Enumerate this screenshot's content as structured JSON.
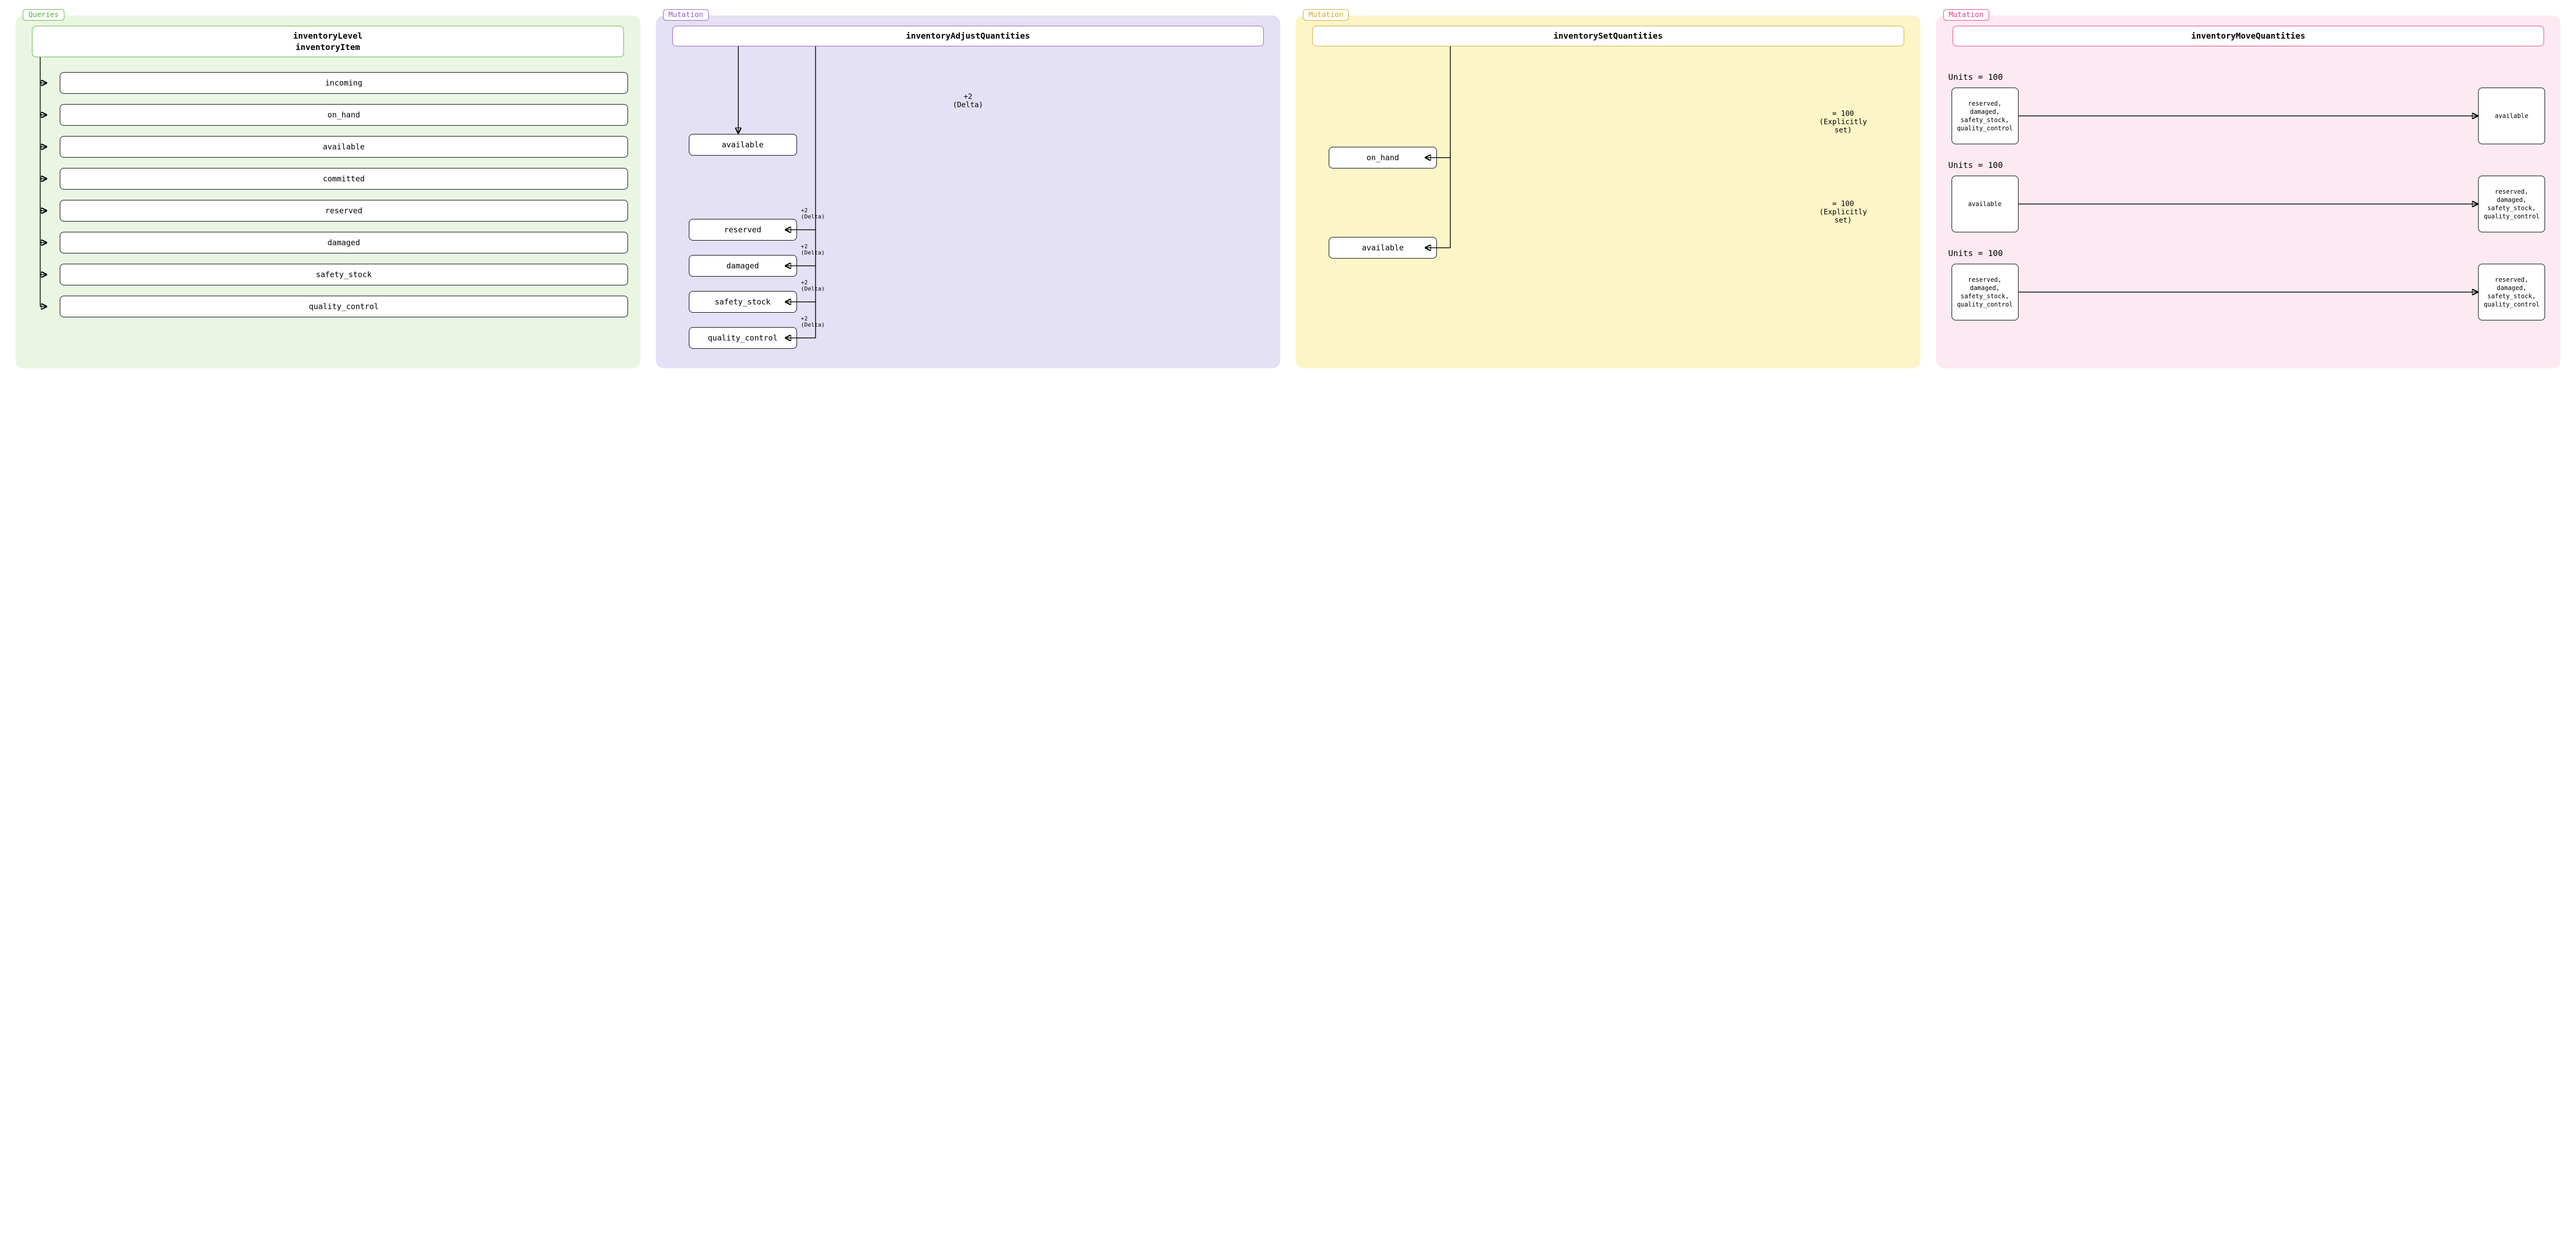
{
  "panels": [
    {
      "tag": "Queries",
      "header": "inventoryLevel\ninventoryItem",
      "items": [
        "incoming",
        "on_hand",
        "available",
        "committed",
        "reserved",
        "damaged",
        "safety_stock",
        "quality_control"
      ]
    },
    {
      "tag": "Mutation",
      "header": "inventoryAdjustQuantities",
      "mainDelta": "+2\n(Delta)",
      "topNode": "available",
      "sideNodes": [
        "reserved",
        "damaged",
        "safety_stock",
        "quality_control"
      ],
      "sideDelta": "+2\n(Delta)"
    },
    {
      "tag": "Mutation",
      "header": "inventorySetQuantities",
      "nodes": [
        "on_hand",
        "available"
      ],
      "setLabel": "= 100\n(Explicitly\nset)"
    },
    {
      "tag": "Mutation",
      "header": "inventoryMoveQuantities",
      "unitsLabel": "Units = 100",
      "rows": [
        {
          "from": "reserved,\ndamaged,\nsafety_stock,\nquality_control",
          "to": "available"
        },
        {
          "from": "available",
          "to": "reserved,\ndamaged,\nsafety_stock,\nquality_control"
        },
        {
          "from": "reserved,\ndamaged,\nsafety_stock,\nquality_control",
          "to": "reserved,\ndamaged,\nsafety_stock,\nquality_control"
        }
      ]
    }
  ]
}
